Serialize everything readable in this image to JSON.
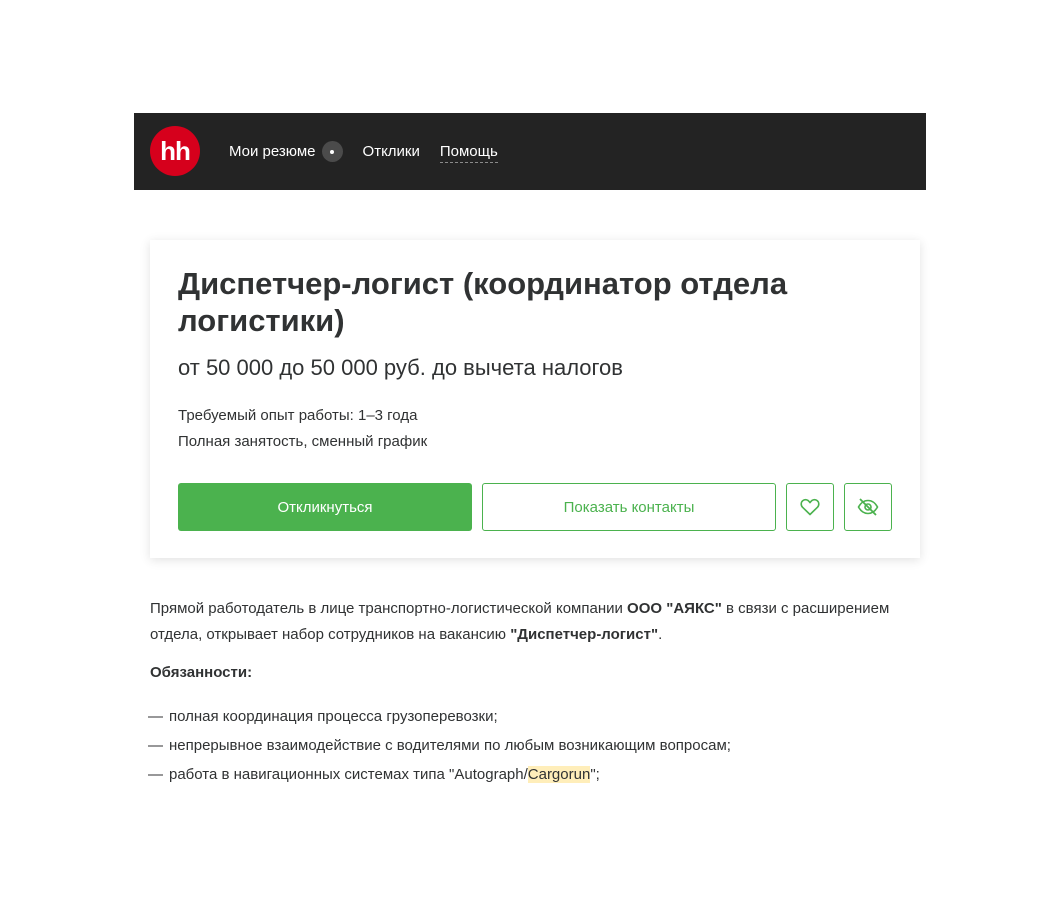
{
  "header": {
    "logo_text": "hh",
    "nav": {
      "resumes_label": "Мои резюме",
      "responses_label": "Отклики",
      "help_label": "Помощь"
    },
    "colors": {
      "background": "#232323",
      "logo": "#d6001c"
    }
  },
  "vacancy": {
    "title": "Диспетчер-логист (координатор отдела логистики)",
    "salary": "от 50 000 до 50 000 руб. до вычета налогов",
    "experience": "Требуемый опыт работы: 1–3 года",
    "employment": "Полная занятость, сменный график",
    "buttons": {
      "respond": "Откликнуться",
      "show_contacts": "Показать контакты",
      "favorite_icon": "heart-icon",
      "hide_icon": "eye-off-icon"
    },
    "colors": {
      "accent": "#4bb24e"
    }
  },
  "description": {
    "intro_1": "Прямой работодатель в лице транспортно-логистической компании ",
    "company": "ООО \"АЯКС\"",
    "intro_2": " в связи с расширением отдела, открывает набор сотрудников на вакансию ",
    "position": "\"Диспетчер-логист\"",
    "intro_3": ".",
    "duties_title": "Обязанности:",
    "dash": "—",
    "duties": [
      "полная координация процесса грузоперевозки;",
      "непрерывное взаимодействие с водителями по любым возникающим вопросам;"
    ],
    "duty_3_before": "работа в навигационных системах типа \"Autograph/",
    "duty_3_highlight": "Cargorun",
    "duty_3_after": "\";"
  }
}
